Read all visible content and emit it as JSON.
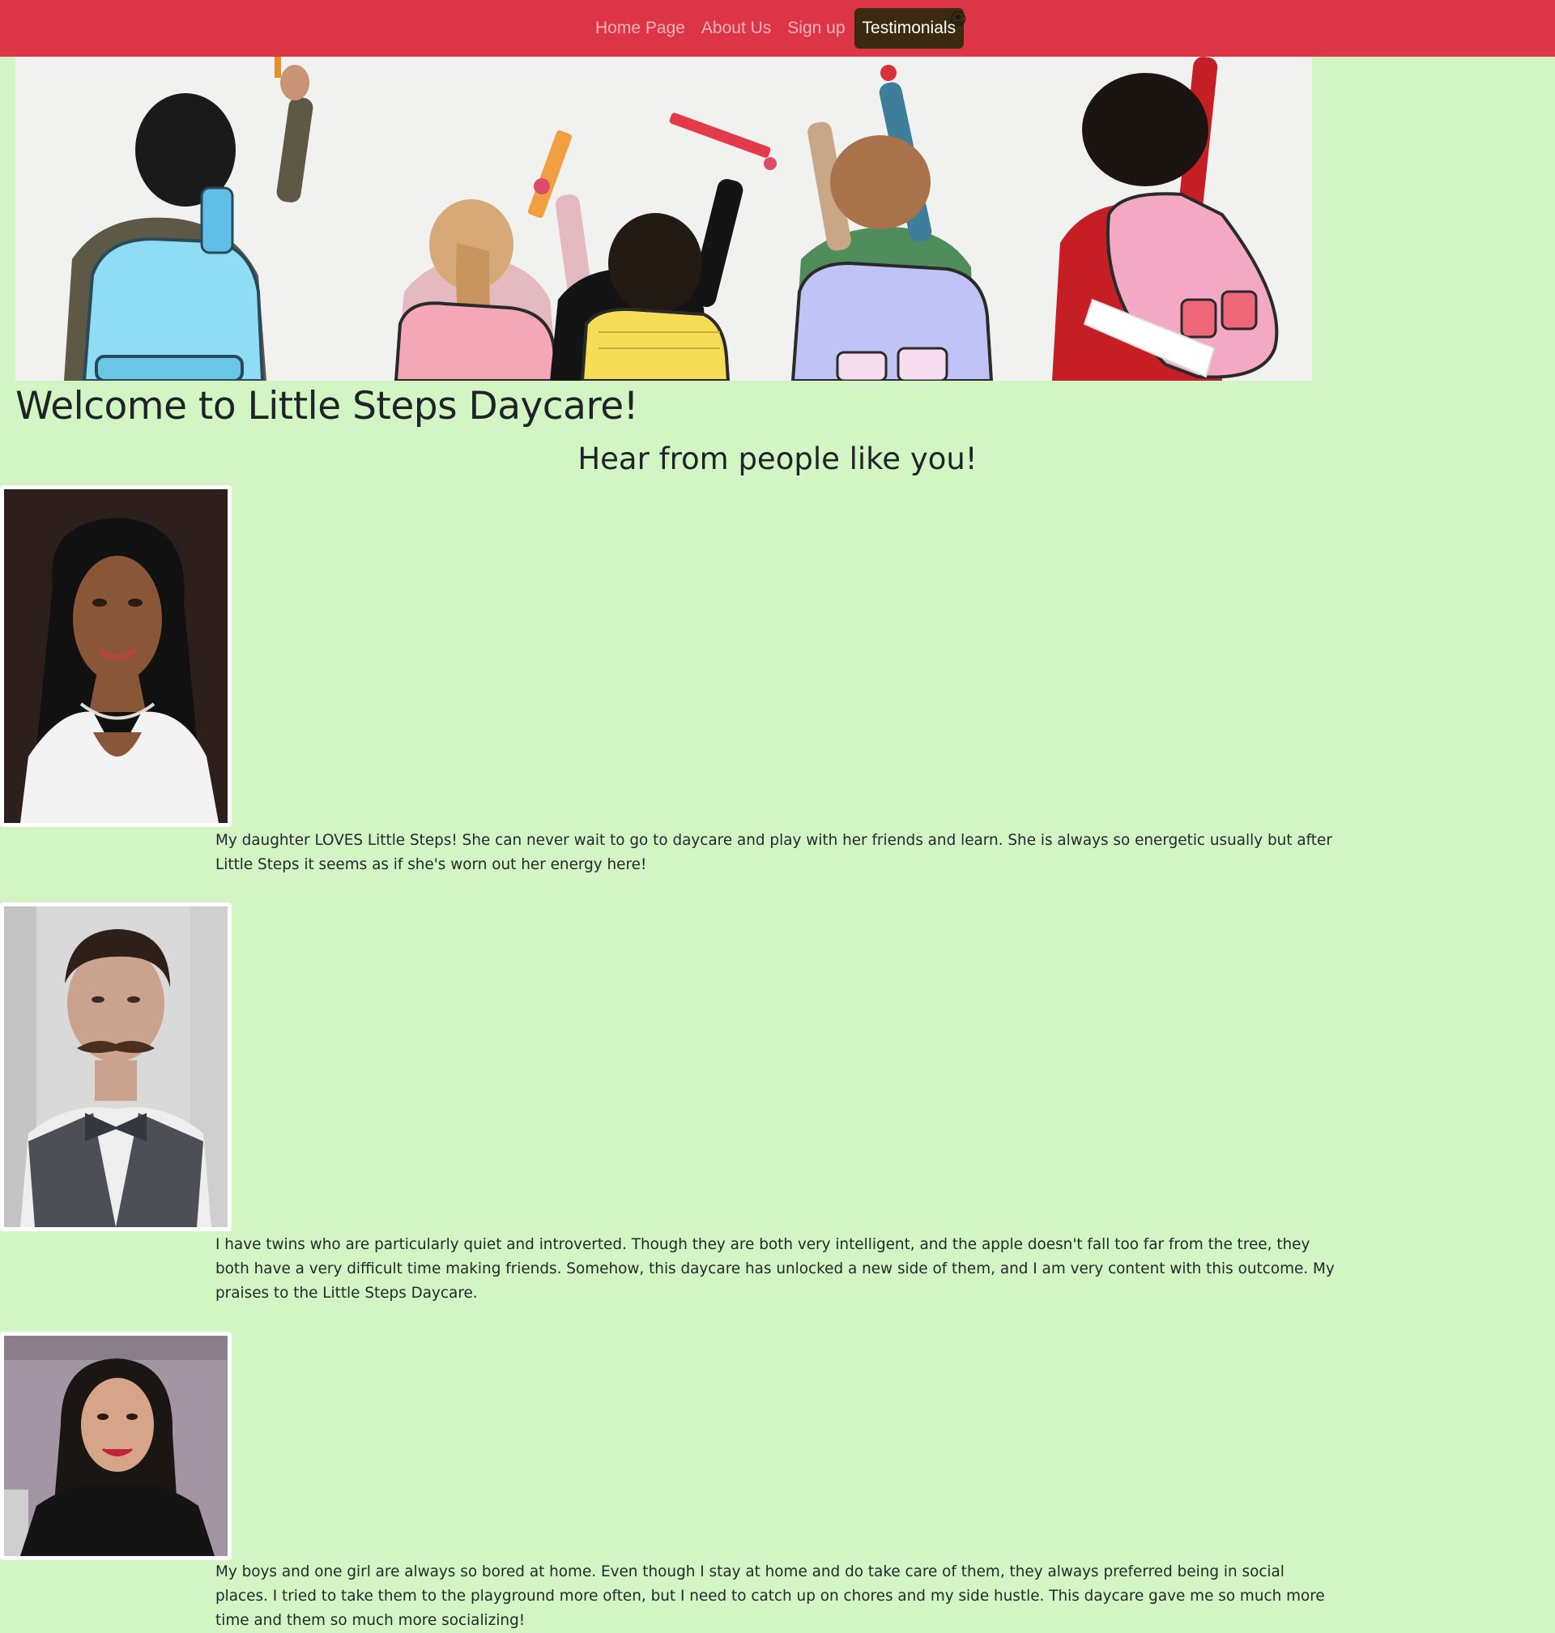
{
  "nav": {
    "items": [
      {
        "label": "Home Page",
        "active": false
      },
      {
        "label": "About Us",
        "active": false
      },
      {
        "label": "Sign up",
        "active": false
      },
      {
        "label": "Testimonials",
        "active": true
      }
    ],
    "user_icon": "user-circle-icon",
    "colors": {
      "bar": "#dc3545",
      "active": "#3b2a0e"
    }
  },
  "hero": {
    "image": "children-with-backpacks-drawing-on-wall"
  },
  "page": {
    "title": "Welcome to Little Steps Daycare!",
    "subtitle": "Hear from people like you!",
    "background": "#d3f5c3"
  },
  "testimonials": [
    {
      "photo": "woman-portrait",
      "text": "My daughter LOVES Little Steps! She can never wait to go to daycare and play with her friends and learn. She is always so energetic usually but after Little Steps it seems as if she's worn out her energy here!"
    },
    {
      "photo": "man-with-mustache-portrait",
      "text": "I have twins who are particularly quiet and introverted. Though they are both very intelligent, and the apple doesn't fall too far from the tree, they both have a very difficult time making friends. Somehow, this daycare has unlocked a new side of them, and I am very content with this outcome. My praises to the Little Steps Daycare."
    },
    {
      "photo": "smiling-woman-portrait",
      "text": "My boys and one girl are always so bored at home. Even though I stay at home and do take care of them, they always preferred being in social places. I tried to take them to the playground more often, but I need to catch up on chores and my side hustle. This daycare gave me so much more time and them so much more socializing!"
    }
  ]
}
